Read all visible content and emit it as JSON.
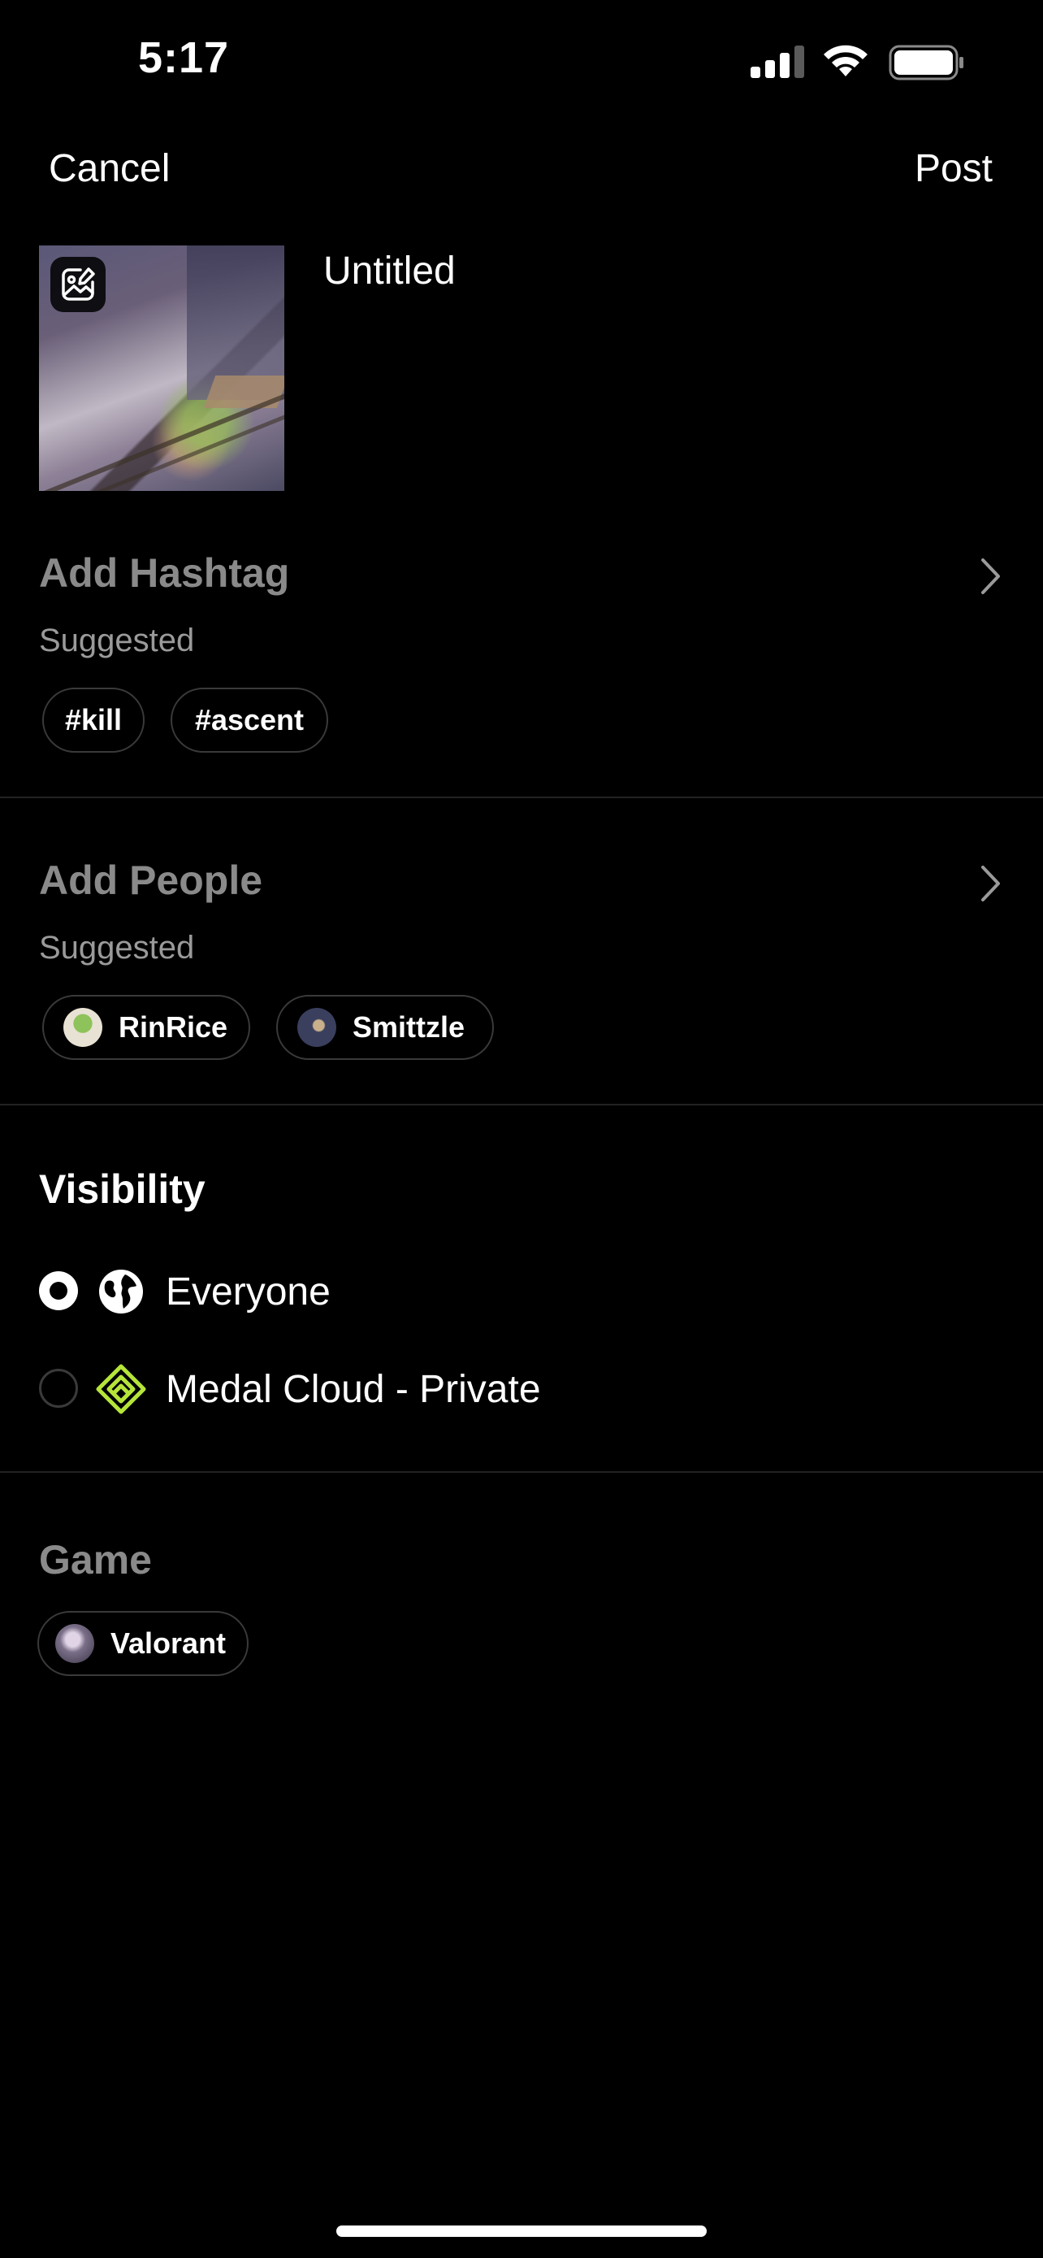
{
  "status_bar": {
    "time": "5:17"
  },
  "nav": {
    "cancel_label": "Cancel",
    "post_label": "Post"
  },
  "clip": {
    "title": "Untitled"
  },
  "hashtags": {
    "heading": "Add Hashtag",
    "suggested_label": "Suggested",
    "items": [
      "#kill",
      "#ascent"
    ]
  },
  "people": {
    "heading": "Add People",
    "suggested_label": "Suggested",
    "items": [
      {
        "name": "RinRice"
      },
      {
        "name": "Smittzle"
      }
    ]
  },
  "visibility": {
    "heading": "Visibility",
    "options": [
      {
        "label": "Everyone",
        "icon": "globe-icon",
        "selected": true
      },
      {
        "label": "Medal Cloud - Private",
        "icon": "medal-cloud-icon",
        "selected": false
      }
    ]
  },
  "game": {
    "heading": "Game",
    "selected": "Valorant"
  },
  "colors": {
    "background": "#000000",
    "muted_heading": "#8a8a8a",
    "chip_border": "#3a3a3a",
    "medal_accent": "#b6e53a"
  }
}
